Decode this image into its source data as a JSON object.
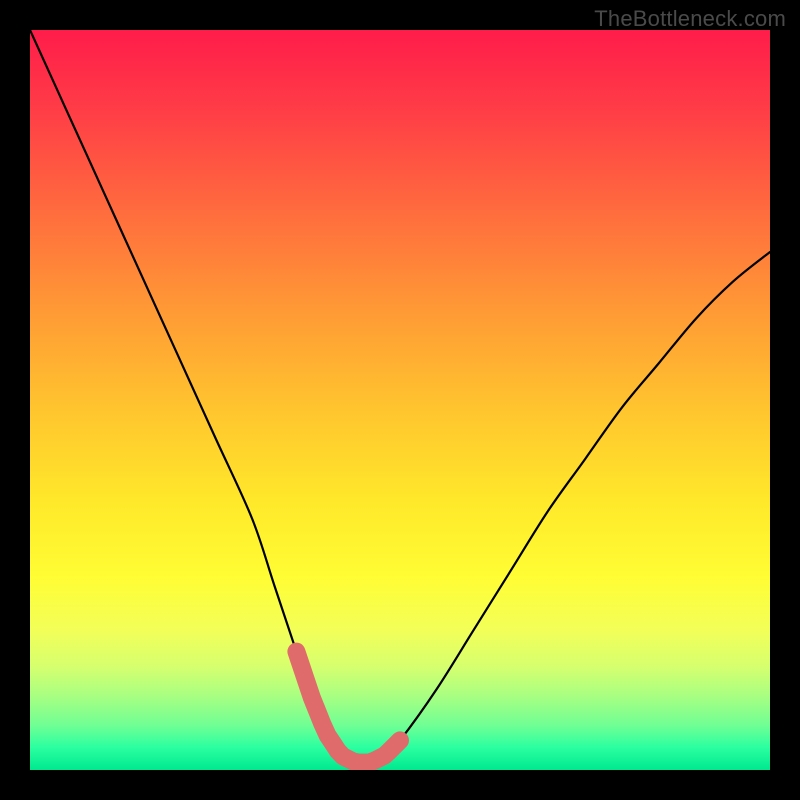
{
  "watermark": {
    "text": "TheBottleneck.com"
  },
  "colors": {
    "background_black": "#000000",
    "gradient_top": "#ff1c4a",
    "gradient_mid": "#ffe92a",
    "gradient_bottom": "#00e98f",
    "curve_stroke": "#000000",
    "marker_stroke": "#e06b6b"
  },
  "chart_data": {
    "type": "line",
    "title": "",
    "xlabel": "",
    "ylabel": "",
    "xlim": [
      0,
      100
    ],
    "ylim": [
      0,
      100
    ],
    "grid": false,
    "legend": false,
    "series": [
      {
        "name": "bottleneck-curve",
        "x": [
          0,
          5,
          10,
          15,
          20,
          25,
          30,
          33,
          36,
          38,
          40,
          42,
          44,
          46,
          48,
          50,
          55,
          60,
          65,
          70,
          75,
          80,
          85,
          90,
          95,
          100
        ],
        "values": [
          100,
          89,
          78,
          67,
          56,
          45,
          34,
          25,
          16,
          10,
          5,
          2,
          1,
          1,
          2,
          4,
          11,
          19,
          27,
          35,
          42,
          49,
          55,
          61,
          66,
          70
        ]
      }
    ],
    "annotations": [
      {
        "name": "optimal-region-marker",
        "x_start": 36,
        "x_end": 50
      }
    ],
    "background_gradient": {
      "axis": "y",
      "stops": [
        {
          "pos": 0.0,
          "color": "#00e98f"
        },
        {
          "pos": 0.06,
          "color": "#6fff94"
        },
        {
          "pos": 0.14,
          "color": "#d6ff6e"
        },
        {
          "pos": 0.26,
          "color": "#fffd34"
        },
        {
          "pos": 0.48,
          "color": "#ffc72e"
        },
        {
          "pos": 0.76,
          "color": "#ff6a3e"
        },
        {
          "pos": 1.0,
          "color": "#ff1c4a"
        }
      ]
    }
  }
}
